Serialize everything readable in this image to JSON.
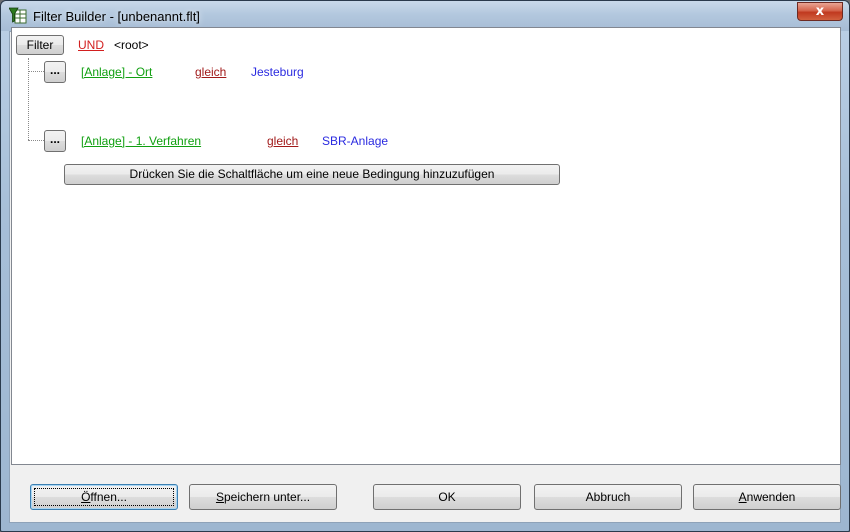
{
  "window": {
    "title": "Filter Builder - [unbenannt.flt]",
    "close_glyph": "x"
  },
  "tree": {
    "root": {
      "filter_button": "Filter",
      "operator": "UND",
      "label": "<root>"
    },
    "conditions": [
      {
        "menu_button": "...",
        "field": "[Anlage] - Ort",
        "comparison": "gleich",
        "value": "Jesteburg"
      },
      {
        "menu_button": "...",
        "field": "[Anlage] - 1. Verfahren",
        "comparison": "gleich",
        "value": "SBR-Anlage"
      }
    ],
    "add_condition_button": "Drücken Sie die Schaltfläche um eine neue Bedingung hinzuzufügen"
  },
  "buttons": {
    "open": "Öffnen...",
    "save_as": "Speichern unter...",
    "ok": "OK",
    "cancel": "Abbruch",
    "apply": "Anwenden"
  },
  "colors": {
    "field": "#11a011",
    "operator": "#d21f1f",
    "comparison": "#a11a1a",
    "value": "#2a2ae0"
  },
  "icons": {
    "title": "filter-table-icon",
    "close": "close-icon"
  }
}
